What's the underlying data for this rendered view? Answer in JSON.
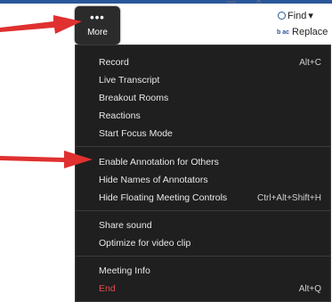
{
  "window": {
    "minimize_glyph": "—",
    "maximize_glyph": "^"
  },
  "ribbon": {
    "find_label": "Find",
    "find_dropdown": "▾",
    "replace_label": "Replace",
    "replace_icon_text": "b ac"
  },
  "more_button": {
    "dots": "•••",
    "label": "More"
  },
  "menu": {
    "groups": [
      [
        {
          "label": "Record",
          "shortcut": "Alt+C"
        },
        {
          "label": "Live Transcript",
          "shortcut": ""
        },
        {
          "label": "Breakout Rooms",
          "shortcut": ""
        },
        {
          "label": "Reactions",
          "shortcut": ""
        },
        {
          "label": "Start Focus Mode",
          "shortcut": ""
        }
      ],
      [
        {
          "label": "Enable Annotation for Others",
          "shortcut": ""
        },
        {
          "label": "Hide Names of Annotators",
          "shortcut": ""
        },
        {
          "label": "Hide Floating Meeting Controls",
          "shortcut": "Ctrl+Alt+Shift+H"
        }
      ],
      [
        {
          "label": "Share sound",
          "shortcut": ""
        },
        {
          "label": "Optimize for video clip",
          "shortcut": ""
        }
      ],
      [
        {
          "label": "Meeting Info",
          "shortcut": ""
        },
        {
          "label": "End",
          "shortcut": "Alt+Q"
        }
      ]
    ]
  },
  "colors": {
    "menu_bg": "#1f1f1f",
    "end_text": "#e05050",
    "arrow": "#e03030",
    "accent": "#2b579a"
  }
}
